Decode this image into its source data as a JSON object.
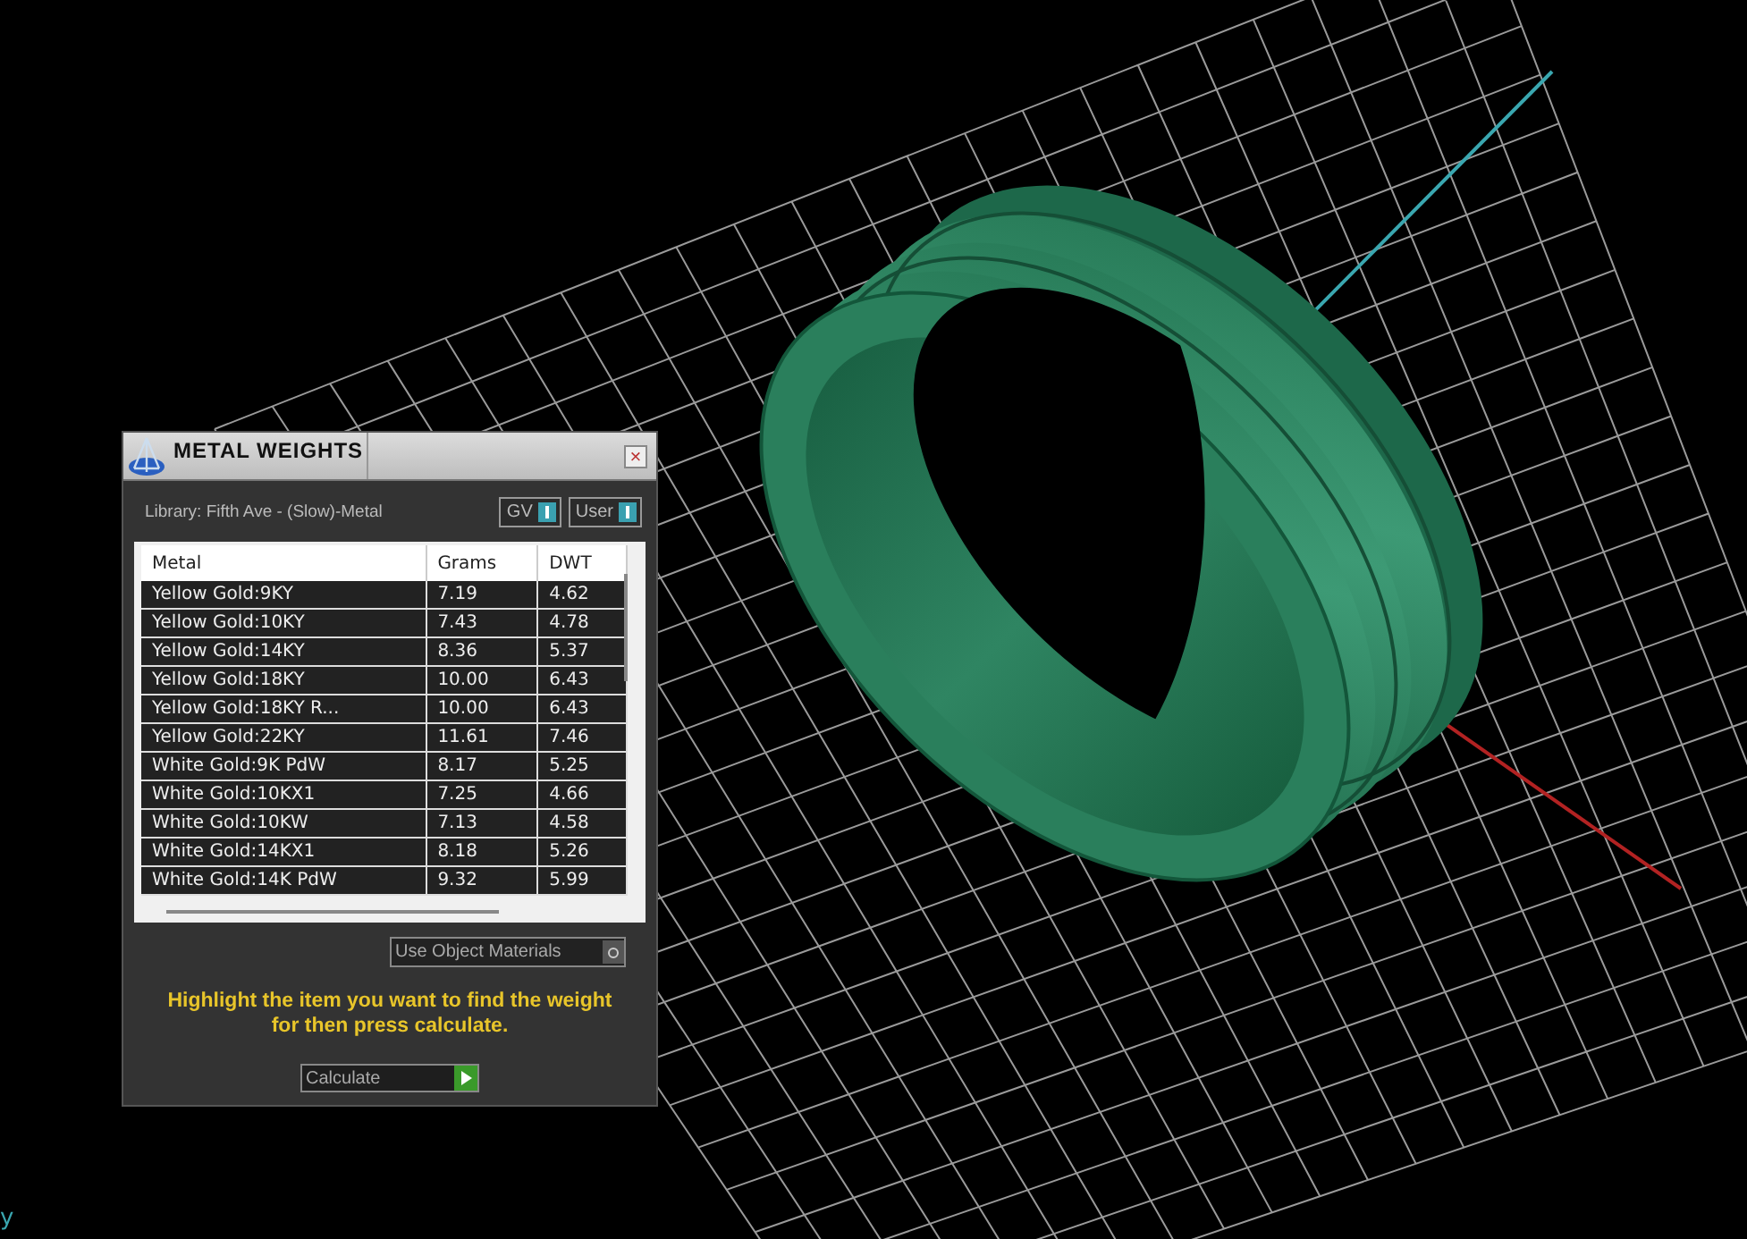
{
  "viewport": {
    "axis_label": "y"
  },
  "panel": {
    "title": "METAL WEIGHTS",
    "close": "×",
    "library": "Library: Fifth Ave - (Slow)-Metal",
    "toggles": [
      {
        "label": "GV",
        "on": true
      },
      {
        "label": "User",
        "on": true
      }
    ],
    "table": {
      "columns": [
        "Metal",
        "Grams",
        "DWT"
      ],
      "rows": [
        [
          "Yellow Gold:9KY",
          "7.19",
          "4.62"
        ],
        [
          "Yellow Gold:10KY",
          "7.43",
          "4.78"
        ],
        [
          "Yellow Gold:14KY",
          "8.36",
          "5.37"
        ],
        [
          "Yellow Gold:18KY",
          "10.00",
          "6.43"
        ],
        [
          "Yellow Gold:18KY R...",
          "10.00",
          "6.43"
        ],
        [
          "Yellow Gold:22KY",
          "11.61",
          "7.46"
        ],
        [
          "White Gold:9K PdW",
          "8.17",
          "5.25"
        ],
        [
          "White Gold:10KX1",
          "7.25",
          "4.66"
        ],
        [
          "White Gold:10KW",
          "7.13",
          "4.58"
        ],
        [
          "White Gold:14KX1",
          "8.18",
          "5.26"
        ],
        [
          "White Gold:14K PdW",
          "9.32",
          "5.99"
        ]
      ]
    },
    "option": {
      "label": "Use Object Materials",
      "checked": false
    },
    "instructions": "Highlight the item you want to find the weight for then press calculate.",
    "button": "Calculate"
  }
}
